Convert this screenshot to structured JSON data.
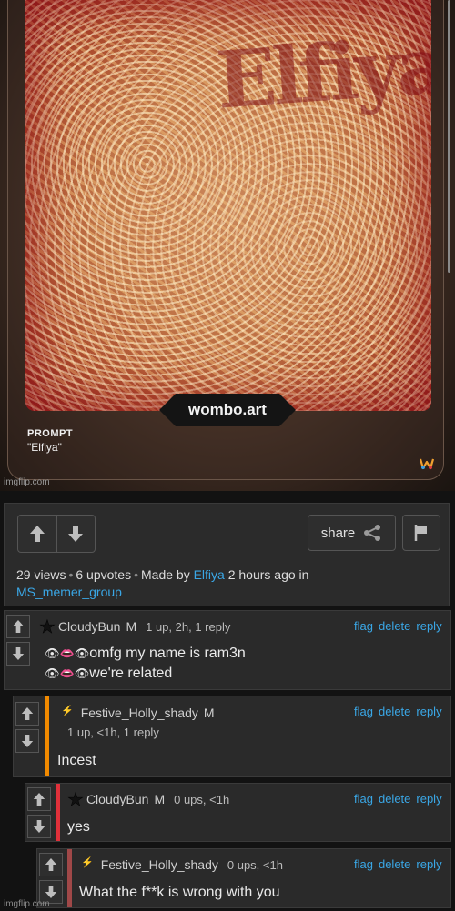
{
  "meme": {
    "art_word": "Elfiya",
    "badge": "wombo.art",
    "prompt_label": "PROMPT",
    "prompt_value": "\"Elfiya\"",
    "watermark": "imgflip.com"
  },
  "post": {
    "share_label": "share",
    "views": "29 views",
    "upvotes": "6 upvotes",
    "made_by_prefix": "Made by",
    "author": "Elfiya",
    "time_in": "2 hours ago in",
    "stream": "MS_memer_group"
  },
  "comments": [
    {
      "user": "CloudyBun",
      "mod": "M",
      "meta": "1 up, 2h, 1 reply",
      "text_line1": "omfg my name is ram3n",
      "text_line2": "we're related",
      "emoji_line1": "👁👄👁",
      "emoji_line2": "👁👄👁"
    },
    {
      "user": "Festive_Holly_shady",
      "mod": "M",
      "meta": "1 up, <1h, 1 reply",
      "text": "Incest",
      "accent": "#f28a00"
    },
    {
      "user": "CloudyBun",
      "mod": "M",
      "meta": "0 ups, <1h",
      "text": "yes",
      "accent": "#e0303a"
    },
    {
      "user": "Festive_Holly_shady",
      "meta": "0 ups, <1h",
      "text": "What the f**k is wrong with you",
      "accent": "#a04848"
    }
  ],
  "actions": {
    "flag": "flag",
    "delete": "delete",
    "reply": "reply"
  },
  "footer": {
    "watermark": "imgflip.com"
  },
  "colors": {
    "link": "#3aa7e6",
    "accent_orange": "#f28a00",
    "accent_red": "#e0303a",
    "accent_dark_red": "#a04848"
  }
}
